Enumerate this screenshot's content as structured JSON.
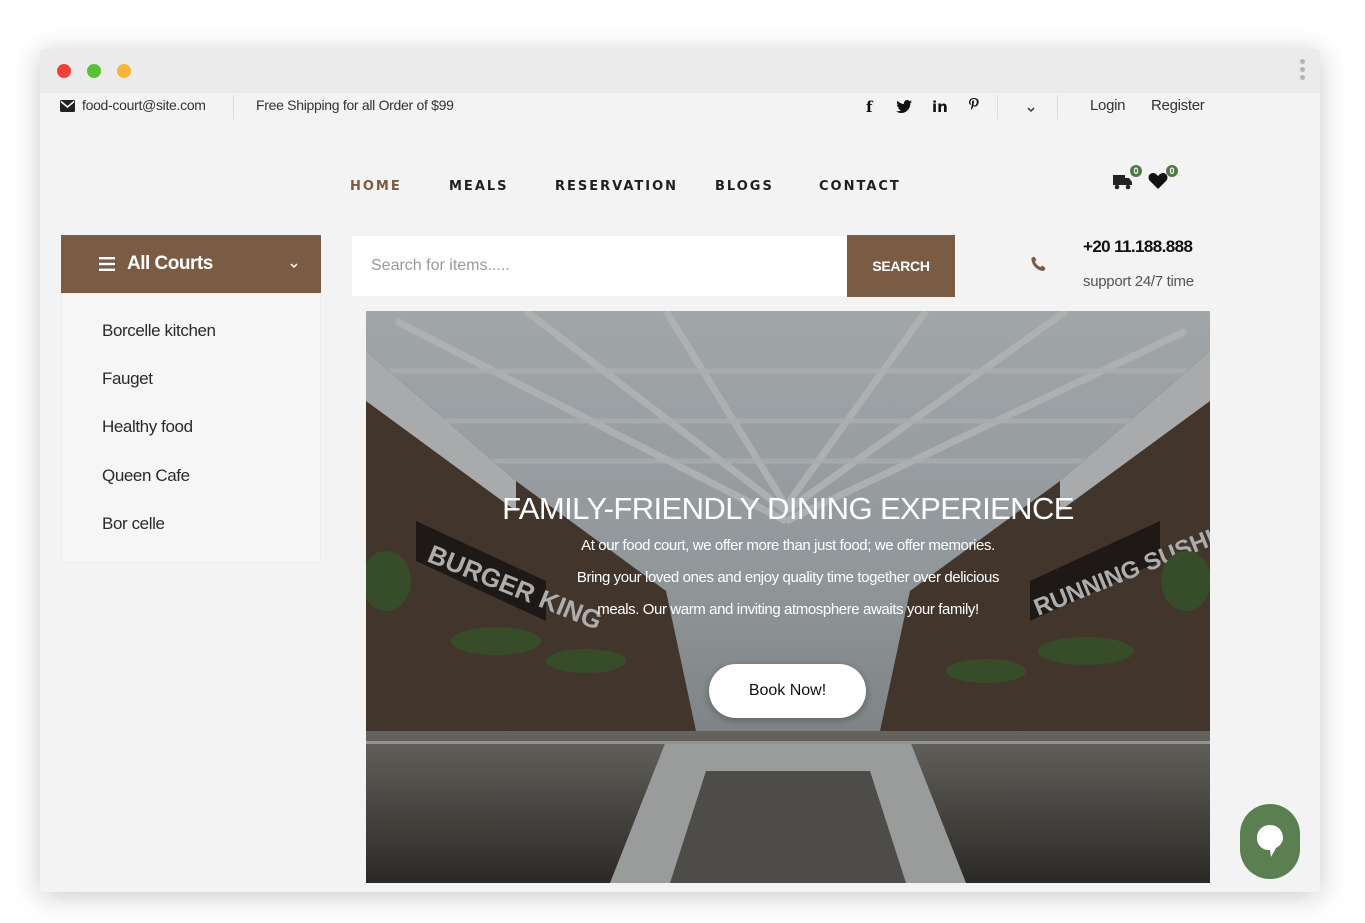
{
  "topbar": {
    "email": "food-court@site.com",
    "shipping": "Free Shipping for all Order of $99",
    "social": [
      {
        "name": "facebook-icon",
        "glyph": "f"
      },
      {
        "name": "twitter-icon",
        "glyph": "t"
      },
      {
        "name": "linkedin-icon",
        "glyph": "in"
      },
      {
        "name": "pinterest-icon",
        "glyph": "p"
      }
    ],
    "login": "Login",
    "register": "Register"
  },
  "nav": {
    "items": [
      "HOME",
      "MEALS",
      "RESERVATION",
      "BLOGS",
      "CONTACT"
    ],
    "active": "HOME",
    "cart_count": "0",
    "wishlist_count": "0"
  },
  "sidebar": {
    "title": "All Courts",
    "items": [
      "Borcelle kitchen",
      "Fauget",
      "Healthy food",
      "Queen Cafe",
      "Bor celle"
    ]
  },
  "search": {
    "placeholder": "Search for items.....",
    "button": "SEARCH"
  },
  "contact": {
    "phone": "+20 11.188.888",
    "support": "support 24/7 time"
  },
  "hero": {
    "title": "FAMILY-FRIENDLY DINING EXPERIENCE",
    "line1": "At our food court, we offer more than just food; we offer memories.",
    "line2": "Bring your loved ones and enjoy quality time together over delicious",
    "line3": "meals. Our warm and inviting atmosphere awaits your family!",
    "button": "Book Now!",
    "sign_left": "BURGER KING",
    "sign_right": "RUNNING SUSHI"
  },
  "colors": {
    "brand_brown": "#7a5b44",
    "nav_active": "#7a5a40",
    "badge_green": "#4e7a43",
    "chat_green": "#5b7f50"
  }
}
